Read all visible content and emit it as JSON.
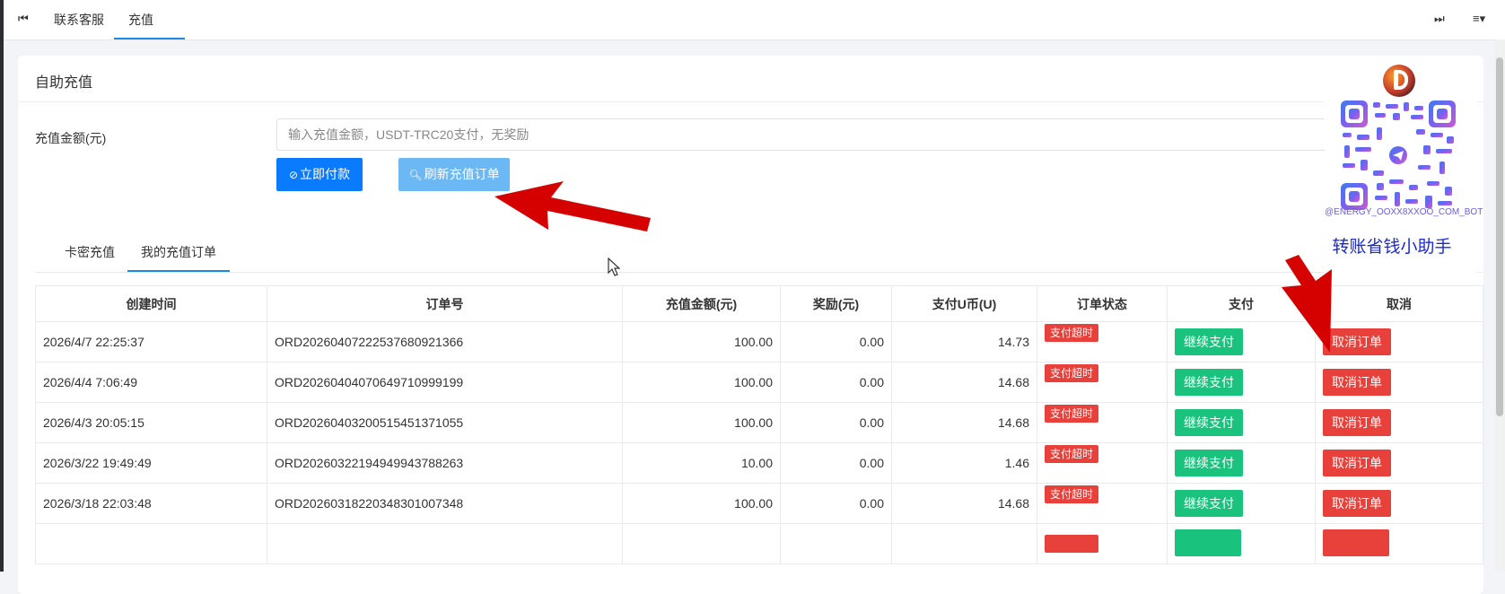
{
  "tabs": {
    "items": [
      {
        "label": "联系客服"
      },
      {
        "label": "充值"
      }
    ],
    "close_glyph": "×"
  },
  "card": {
    "title": "自助充值",
    "amount_label": "充值金额(元)",
    "amount_placeholder": "输入充值金额，USDT-TRC20支付，无奖励",
    "pay_label": "立即付款",
    "refresh_label": "刷新充值订单"
  },
  "subtabs": {
    "card_recharge": "卡密充值",
    "my_orders": "我的充值订单"
  },
  "table": {
    "headers": [
      "创建时间",
      "订单号",
      "充值金额(元)",
      "奖励(元)",
      "支付U币(U)",
      "订单状态",
      "支付",
      "取消"
    ],
    "rows": [
      {
        "time": "2026/4/7 22:25:37",
        "order": "ORD20260407222537680921366",
        "amount": "100.00",
        "reward": "0.00",
        "usdt": "14.73",
        "status": "支付超时",
        "pay": "继续支付",
        "cancel": "取消订单"
      },
      {
        "time": "2026/4/4 7:06:49",
        "order": "ORD20260404070649710999199",
        "amount": "100.00",
        "reward": "0.00",
        "usdt": "14.68",
        "status": "支付超时",
        "pay": "继续支付",
        "cancel": "取消订单"
      },
      {
        "time": "2026/4/3 20:05:15",
        "order": "ORD20260403200515451371055",
        "amount": "100.00",
        "reward": "0.00",
        "usdt": "14.68",
        "status": "支付超时",
        "pay": "继续支付",
        "cancel": "取消订单"
      },
      {
        "time": "2026/3/22 19:49:49",
        "order": "ORD20260322194949943788263",
        "amount": "10.00",
        "reward": "0.00",
        "usdt": "1.46",
        "status": "支付超时",
        "pay": "继续支付",
        "cancel": "取消订单"
      },
      {
        "time": "2026/3/18 22:03:48",
        "order": "ORD20260318220348301007348",
        "amount": "100.00",
        "reward": "0.00",
        "usdt": "14.68",
        "status": "支付超时",
        "pay": "继续支付",
        "cancel": "取消订单"
      },
      {
        "time": "",
        "order": "",
        "amount": "",
        "reward": "",
        "usdt": "",
        "status": "",
        "pay": "",
        "cancel": ""
      }
    ]
  },
  "overlay": {
    "bot_name": "@ENERGY_OOXX8XXOO_COM_BOT",
    "helper_text": "转账省钱小助手"
  },
  "colors": {
    "primary": "#0a7bff",
    "refresh": "#6cb8f5",
    "success": "#19c37d",
    "danger": "#e8403a",
    "amount_green": "#2a8a1a",
    "arrow_red": "#d50000",
    "helper_blue": "#1a28d8"
  },
  "icons": {
    "first_page": "first-page-icon",
    "last_page": "last-page-icon",
    "menu": "menu-icon",
    "pay": "check-circle-icon",
    "refresh": "search-icon"
  }
}
